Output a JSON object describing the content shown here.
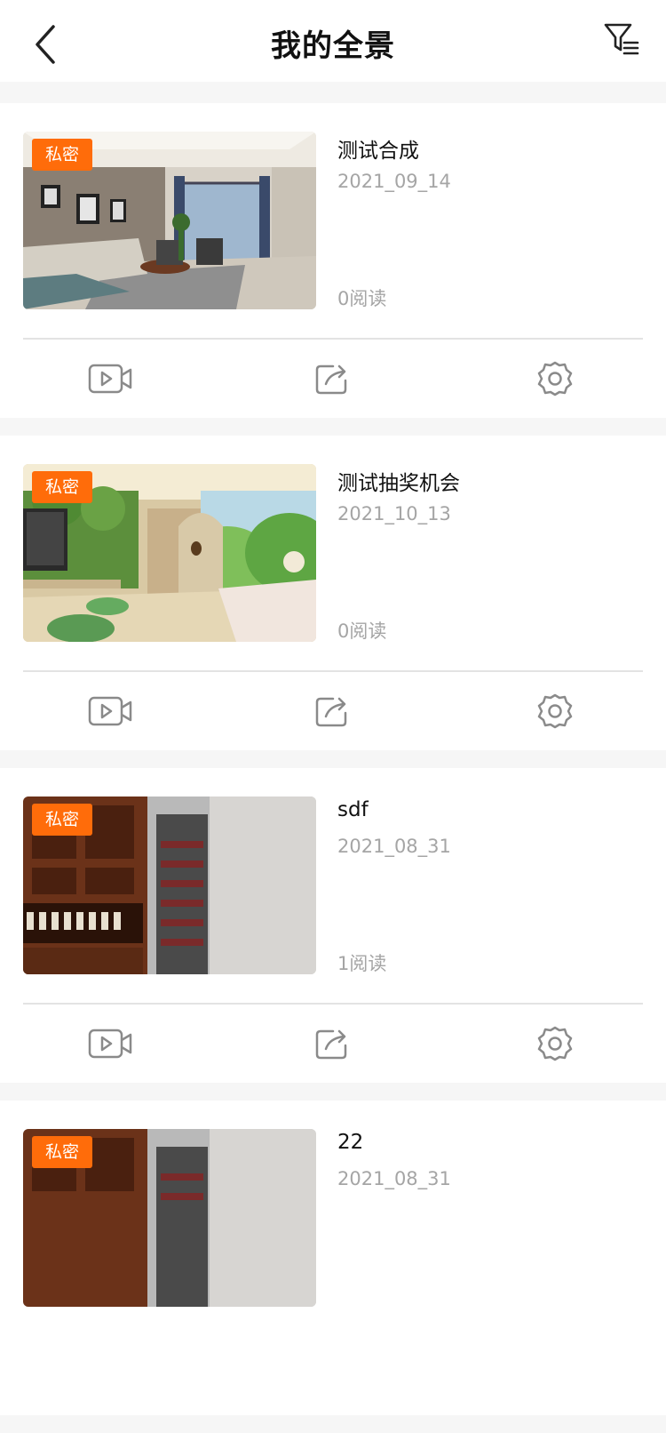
{
  "header": {
    "title": "我的全景",
    "back_icon": "chevron-left-icon",
    "filter_icon": "filter-list-icon"
  },
  "colors": {
    "accent": "#ff6c0a",
    "muted_text": "#a5a5a5",
    "icon_gray": "#8a8a8a"
  },
  "items": [
    {
      "badge": "私密",
      "title": "测试合成",
      "date": "2021_09_14",
      "reads": "0阅读",
      "thumb": "living-room"
    },
    {
      "badge": "私密",
      "title": "测试抽奖机会",
      "date": "2021_10_13",
      "reads": "0阅读",
      "thumb": "kids-room"
    },
    {
      "badge": "私密",
      "title": "sdf",
      "date": "2021_08_31",
      "reads": "1阅读",
      "thumb": "wine-cellar"
    },
    {
      "badge": "私密",
      "title": "22",
      "date": "2021_08_31",
      "reads": "",
      "thumb": "wine-cellar"
    }
  ],
  "actions": {
    "video": "video-icon",
    "share": "share-icon",
    "settings": "gear-icon"
  }
}
